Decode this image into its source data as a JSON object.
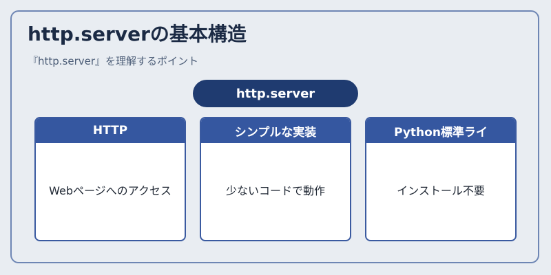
{
  "diagram": {
    "title": "http.serverの基本構造",
    "subtitle": "『http.server』を理解するポイント",
    "root_label": "http.server",
    "cards": [
      {
        "header": "HTTP",
        "body": "Webページへのアクセス"
      },
      {
        "header": "シンプルな実装",
        "body": "少ないコードで動作"
      },
      {
        "header": "Python標準ライ",
        "body": "インストール不要"
      }
    ]
  },
  "colors": {
    "background": "#e9edf2",
    "frame_border": "#6e86b4",
    "root_pill": "#1f3b70",
    "card_header": "#3557a0",
    "card_border": "#3a5aa0"
  }
}
